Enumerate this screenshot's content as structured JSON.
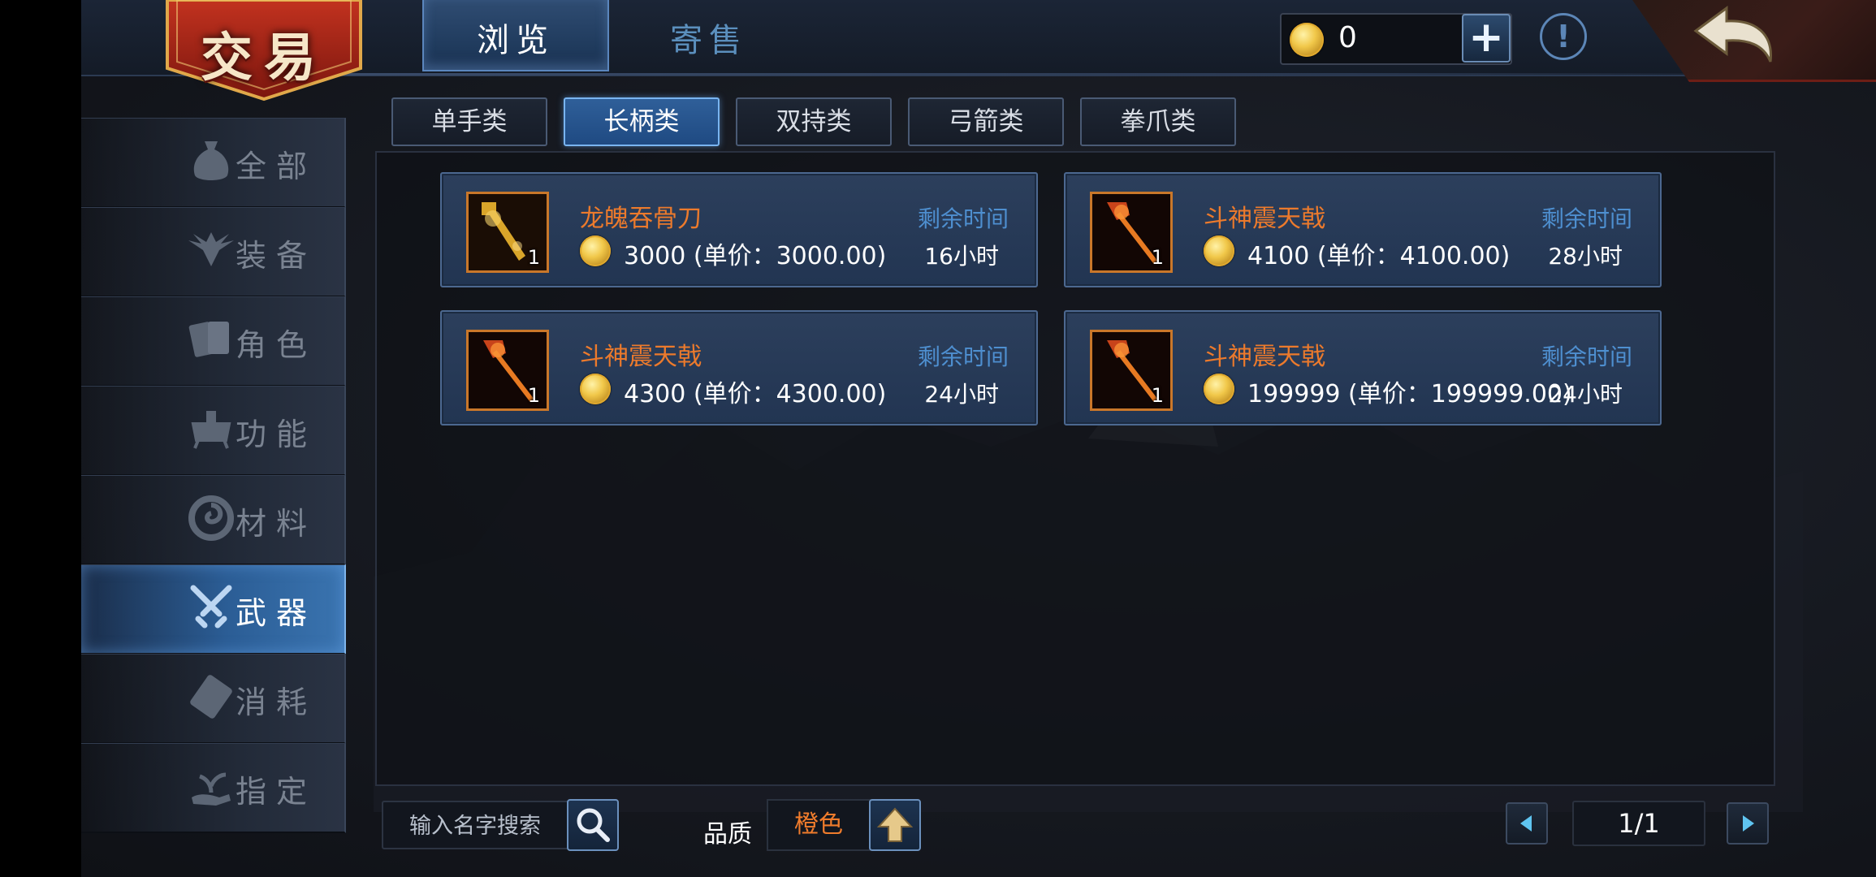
{
  "title": "交易",
  "tabs": {
    "browse": "浏览",
    "consign": "寄售",
    "active": "browse"
  },
  "currency": {
    "amount": "0",
    "icon": "gold-coin-icon"
  },
  "sidebar": {
    "items": [
      {
        "label": "全部",
        "icon": "money-bag-icon"
      },
      {
        "label": "装备",
        "icon": "wings-emblem-icon"
      },
      {
        "label": "角色",
        "icon": "cards-icon"
      },
      {
        "label": "功能",
        "icon": "furnace-icon"
      },
      {
        "label": "材料",
        "icon": "swirl-icon"
      },
      {
        "label": "武器",
        "icon": "crossed-swords-icon"
      },
      {
        "label": "消耗",
        "icon": "scroll-card-icon"
      },
      {
        "label": "指定",
        "icon": "hand-sprout-icon"
      }
    ],
    "active": "武器"
  },
  "subcategories": {
    "items": [
      "单手类",
      "长柄类",
      "双持类",
      "弓箭类",
      "拳爪类"
    ],
    "active": "长柄类"
  },
  "listings": [
    {
      "name": "龙魄吞骨刀",
      "price": "3000 (单价：3000.00)",
      "time_label": "剩余时间",
      "time": "16小时",
      "qty": "1",
      "icon": "golden-blade-icon"
    },
    {
      "name": "斗神震天戟",
      "price": "4100 (单价：4100.00)",
      "time_label": "剩余时间",
      "time": "28小时",
      "qty": "1",
      "icon": "flame-halberd-icon"
    },
    {
      "name": "斗神震天戟",
      "price": "4300 (单价：4300.00)",
      "time_label": "剩余时间",
      "time": "24小时",
      "qty": "1",
      "icon": "flame-halberd-icon"
    },
    {
      "name": "斗神震天戟",
      "price": "199999 (单价：199999.00)",
      "time_label": "剩余时间",
      "time": "24小时",
      "qty": "1",
      "icon": "flame-halberd-icon"
    }
  ],
  "search": {
    "placeholder": "输入名字搜索"
  },
  "quality": {
    "label": "品质",
    "value": "橙色"
  },
  "pagination": {
    "current": "1/1"
  },
  "colors": {
    "accent_blue": "#3a74b0",
    "item_name_orange": "#ec7a2c",
    "time_label_blue": "#4e8fd0",
    "title_red": "#a0241a"
  }
}
